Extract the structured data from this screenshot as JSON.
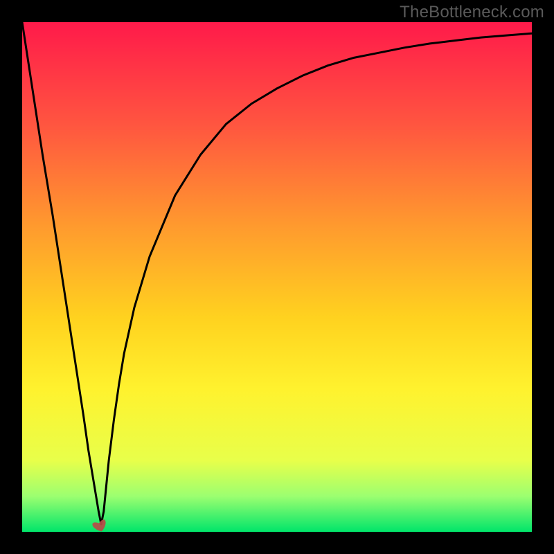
{
  "watermark": "TheBottleneck.com",
  "chart_data": {
    "type": "line",
    "title": "",
    "xlabel": "",
    "ylabel": "",
    "xlim": [
      0,
      100
    ],
    "ylim": [
      0,
      100
    ],
    "x": [
      0,
      2,
      4,
      6,
      8,
      10,
      12,
      13,
      14,
      15,
      15.5,
      16,
      17,
      18,
      19,
      20,
      22,
      25,
      30,
      35,
      40,
      45,
      50,
      55,
      60,
      65,
      70,
      75,
      80,
      85,
      90,
      95,
      100
    ],
    "values": [
      100,
      87,
      74,
      62,
      49,
      36,
      23,
      16,
      10,
      4,
      1.5,
      4,
      14,
      22,
      29,
      35,
      44,
      54,
      66,
      74,
      80,
      84,
      87,
      89.5,
      91.5,
      93,
      94,
      95,
      95.8,
      96.4,
      97,
      97.4,
      97.8
    ],
    "series": [
      {
        "name": "bottleneck-curve",
        "color": "#000000"
      }
    ],
    "markers": [
      {
        "name": "heart-min",
        "x": 15.3,
        "y": 1.0,
        "color": "#b94a48"
      }
    ],
    "background_gradient": {
      "stops": [
        {
          "offset": 0.0,
          "color": "#ff1a4a"
        },
        {
          "offset": 0.2,
          "color": "#ff5540"
        },
        {
          "offset": 0.4,
          "color": "#ff9a2e"
        },
        {
          "offset": 0.58,
          "color": "#ffd21f"
        },
        {
          "offset": 0.72,
          "color": "#fff22e"
        },
        {
          "offset": 0.86,
          "color": "#e8ff4a"
        },
        {
          "offset": 0.93,
          "color": "#9cff70"
        },
        {
          "offset": 1.0,
          "color": "#00e56a"
        }
      ]
    }
  }
}
